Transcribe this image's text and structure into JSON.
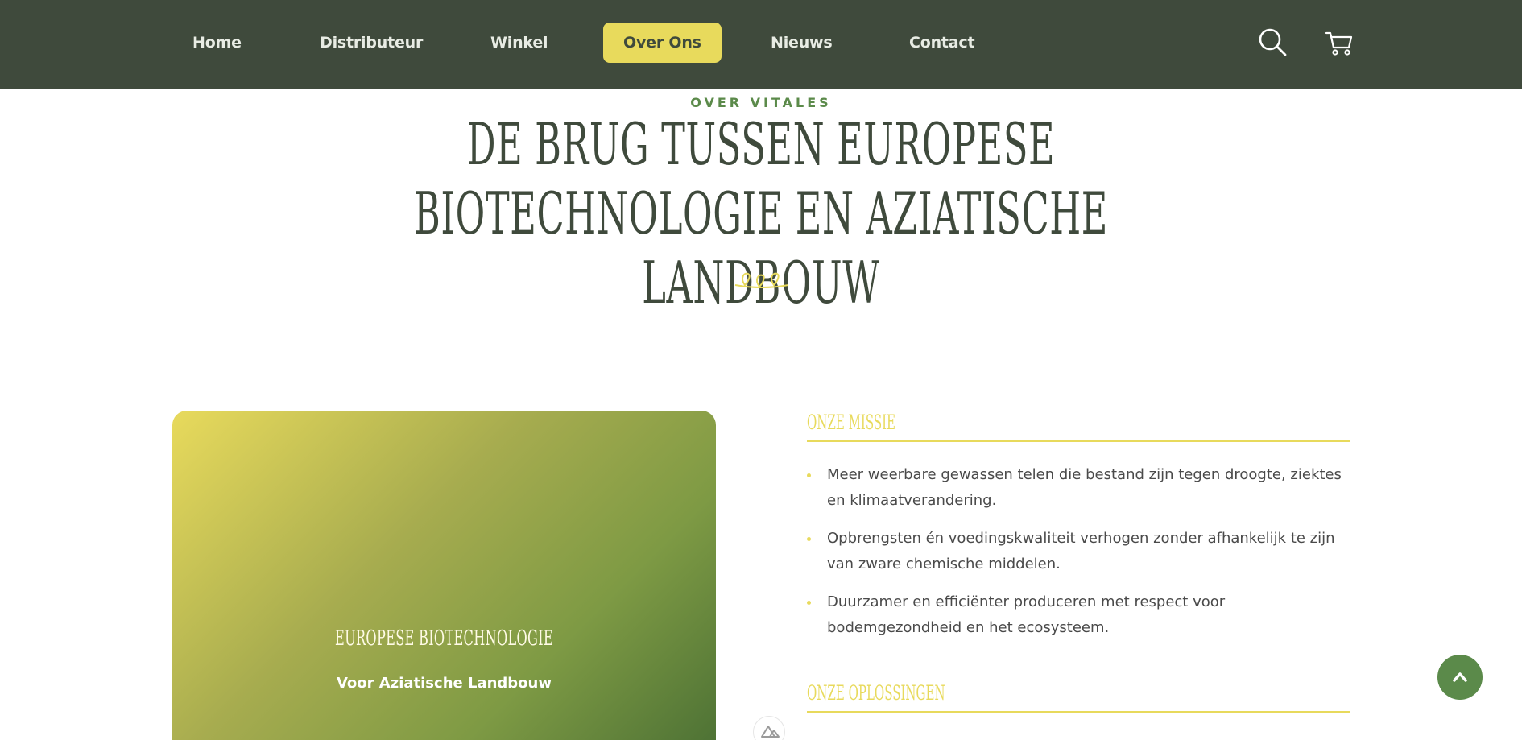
{
  "nav": {
    "items": [
      {
        "label": "Home"
      },
      {
        "label": "Distributeur"
      },
      {
        "label": "Winkel"
      },
      {
        "label": "Over Ons",
        "active": true
      },
      {
        "label": "Nieuws"
      },
      {
        "label": "Contact"
      }
    ],
    "icons": [
      "search-icon",
      "cart-icon"
    ]
  },
  "hero": {
    "eyebrow": "OVER VITALES",
    "title": "DE BRUG TUSSEN EUROPESE BIOTECHNOLOGIE EN AZIATISCHE LANDBOUW",
    "ornament_icon": "leaf-ornament-icon"
  },
  "card": {
    "title": "EUROPESE BIOTECHNOLOGIE",
    "subtitle": "Voor Aziatische Landbouw"
  },
  "mission": {
    "heading": "ONZE MISSIE",
    "items": [
      "Meer weerbare gewassen telen die bestand zijn tegen droogte, ziektes en klimaatverandering.",
      "Opbrengsten én voedingskwaliteit verhogen zonder afhankelijk te zijn van zware chemische middelen.",
      "Duurzamer en efficiënter produceren met respect voor bodemgezondheid en het ecosysteem."
    ]
  },
  "solutions": {
    "heading": "ONZE OPLOSSINGEN"
  },
  "floating": {
    "scroll_top_icon": "chevron-up-icon",
    "badge_icon": "nuxt-logo-icon"
  },
  "colors": {
    "nav_bg": "#3f4a3c",
    "accent_yellow": "#e8da5c",
    "accent_green": "#5b8a4a",
    "title_text": "#3f4a3c"
  }
}
